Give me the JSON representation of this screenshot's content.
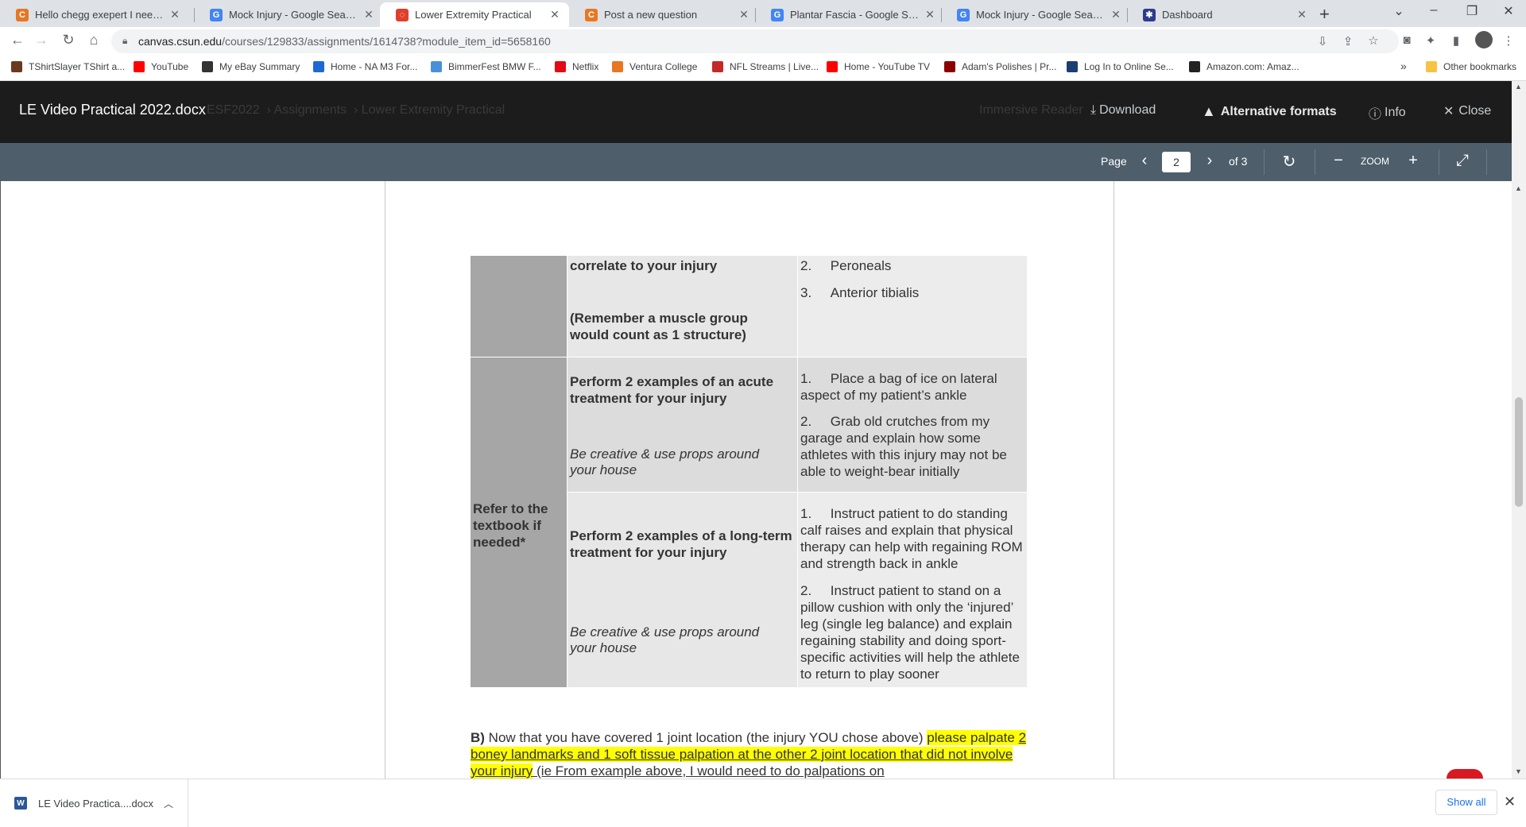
{
  "browser": {
    "tabs": [
      {
        "title": "Hello chegg exepert I need help",
        "icon": "chegg-icon",
        "color": "#e87722",
        "letter": "C"
      },
      {
        "title": "Mock Injury - Google Search",
        "icon": "google-icon",
        "color": "#4285f4",
        "letter": "G"
      },
      {
        "title": "Lower Extremity Practical",
        "icon": "canvas-icon",
        "color": "#e13f2b",
        "letter": "◌"
      },
      {
        "title": "Post a new question",
        "icon": "chegg-icon",
        "color": "#e87722",
        "letter": "C"
      },
      {
        "title": "Plantar Fascia - Google Search",
        "icon": "google-icon",
        "color": "#4285f4",
        "letter": "G"
      },
      {
        "title": "Mock Injury - Google Search",
        "icon": "google-icon",
        "color": "#4285f4",
        "letter": "G"
      },
      {
        "title": "Dashboard",
        "icon": "dashboard-icon",
        "color": "#2d3b8c",
        "letter": "✱"
      }
    ],
    "url_host": "canvas.csun.edu",
    "url_path": "/courses/129833/assignments/1614738?module_item_id=5658160",
    "bookmarks": [
      {
        "label": "TShirtSlayer TShirt a...",
        "color": "#6b3a1e"
      },
      {
        "label": "YouTube",
        "color": "#ff0000"
      },
      {
        "label": "My eBay Summary",
        "color": "#333333"
      },
      {
        "label": "Home - NA M3 For...",
        "color": "#1c69d4"
      },
      {
        "label": "BimmerFest BMW F...",
        "color": "#4a90d9"
      },
      {
        "label": "Netflix",
        "color": "#e50914"
      },
      {
        "label": "Ventura College",
        "color": "#e87722"
      },
      {
        "label": "NFL Streams | Live...",
        "color": "#c62828"
      },
      {
        "label": "Home - YouTube TV",
        "color": "#ff0000"
      },
      {
        "label": "Adam's Polishes | Pr...",
        "color": "#8b0000"
      },
      {
        "label": "Log In to Online Se...",
        "color": "#1a3e72"
      },
      {
        "label": "Amazon.com: Amaz...",
        "color": "#222222"
      }
    ],
    "more_bookmarks": "»",
    "other_bookmarks": "Other bookmarks"
  },
  "viewer": {
    "doc_title": "LE Video Practical 2022.docx",
    "ghost_breadcrumb": "ESF2022  › Assignments  › Lower Extremity Practical",
    "ghost_right": "Immersive Reader",
    "download_label": "Download",
    "alt_formats_label": "Alternative formats",
    "info_label": "Info",
    "close_label": "Close",
    "page_label": "Page",
    "page_current": "2",
    "page_total": "of 3",
    "zoom_label": "ZOOM"
  },
  "document": {
    "row1": {
      "col2_bold_a": "correlate to your injury",
      "col2_bold_b": "(Remember a muscle group would count as 1 structure)",
      "items": [
        "2.     Peroneals",
        "3.     Anterior tibialis"
      ]
    },
    "refer_text": "Refer to the textbook if needed*",
    "row2": {
      "heading": "Perform 2 examples of an acute treatment for your injury",
      "note": "Be creative & use props around your house",
      "items": [
        "1.     Place a bag of ice on lateral aspect of my patient’s ankle",
        "2.     Grab old crutches from my garage and explain how some athletes with this injury may not be able to weight-bear initially"
      ]
    },
    "row3": {
      "heading": "Perform 2 examples of a long-term treatment for your injury",
      "note": "Be creative & use props around your house",
      "items": [
        "1.     Instruct patient to do standing calf raises and explain that physical therapy can help with regaining ROM and strength back in ankle",
        "2.     Instruct patient to stand on a pillow cushion with only the ‘injured’ leg (single leg balance) and explain regaining stability and doing sport-specific activities will help the athlete to return to play sooner"
      ]
    },
    "paraB": {
      "label": "B)",
      "text1": " Now that you have covered 1 joint location (the injury YOU chose above) ",
      "hl1": "please palpate ",
      "hl2": "2 boney landmarks and 1 soft tissue palpation at the other 2 joint location that did not involve your injury",
      "text2": " (ie From example above, I would need to do palpations on"
    }
  },
  "downloads": {
    "file_label": "LE Video Practica....docx",
    "show_all": "Show all"
  }
}
